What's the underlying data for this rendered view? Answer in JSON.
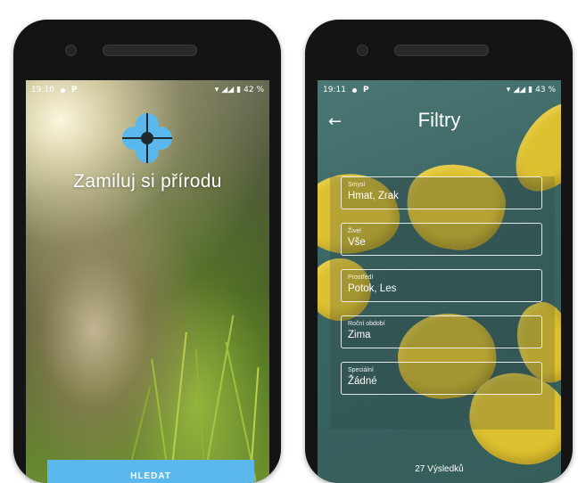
{
  "left_screen": {
    "status": {
      "time": "19:10",
      "battery": "42 %"
    },
    "tagline": "Zamiluj si přírodu",
    "search_button": "HLEDAT",
    "logo_icon": "flower-icon",
    "logo_color": "#5bb8ec"
  },
  "right_screen": {
    "status": {
      "time": "19:11",
      "battery": "43 %"
    },
    "title": "Filtry",
    "back_icon": "arrow-left-icon",
    "filters": [
      {
        "label": "Smysl",
        "value": "Hmat, Zrak"
      },
      {
        "label": "Živel",
        "value": "Vše"
      },
      {
        "label": "Prostředí",
        "value": "Potok, Les"
      },
      {
        "label": "Roční období",
        "value": "Zima"
      },
      {
        "label": "Speciální",
        "value": "Žádné"
      }
    ],
    "results": "27 Výsledků"
  },
  "colors": {
    "accent": "#5bb8ec",
    "leaf": "#dec131",
    "water": "#3f6b68"
  }
}
